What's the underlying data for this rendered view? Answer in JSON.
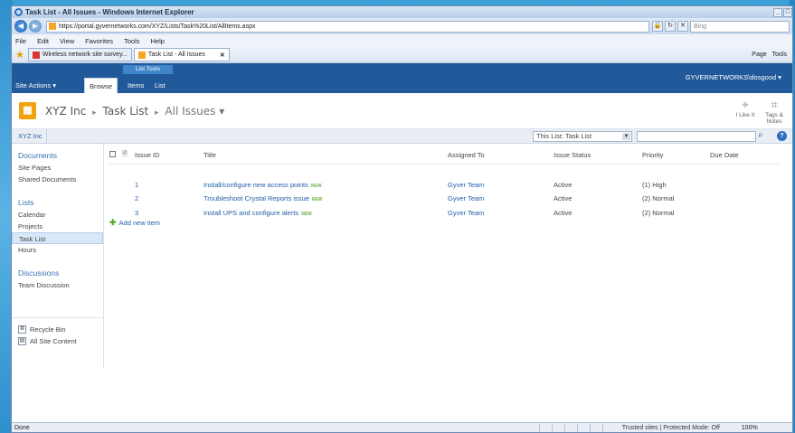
{
  "window": {
    "title": "Task List - All Issues - Windows Internet Explorer",
    "url": "https://portal.gyvernetworks.com/XYZ/Lists/Task%20List/AllItems.aspx",
    "search_placeholder": "Bing"
  },
  "menu": [
    "File",
    "Edit",
    "View",
    "Favorites",
    "Tools",
    "Help"
  ],
  "favorites": {
    "tabs": [
      {
        "label": "Wireless network site survey..."
      },
      {
        "label": "Task List - All Issues"
      }
    ],
    "commands": [
      "Page",
      "Tools"
    ]
  },
  "ribbon": {
    "site_actions": "Site Actions",
    "context_label": "List Tools",
    "tabs": [
      "Browse",
      "Items",
      "List"
    ],
    "user": "GYVERNETWORKS\\dosgood"
  },
  "title_area": {
    "site": "XYZ Inc",
    "list": "Task List",
    "view": "All Issues",
    "i_like_it": "I Like It",
    "tags_notes": "Tags & Notes"
  },
  "search_row": {
    "site_link": "XYZ Inc",
    "scope": "This List: Task List"
  },
  "leftnav": {
    "documents_header": "Documents",
    "documents": [
      "Site Pages",
      "Shared Documents"
    ],
    "lists_header": "Lists",
    "lists": [
      "Calendar",
      "Projects",
      "Task List",
      "Hours"
    ],
    "discussions_header": "Discussions",
    "discussions": [
      "Team Discussion"
    ],
    "footer": [
      "Recycle Bin",
      "All Site Content"
    ]
  },
  "table": {
    "headers": [
      "Issue ID",
      "Title",
      "Assigned To",
      "Issue Status",
      "Priority",
      "Due Date"
    ],
    "rows": [
      {
        "id": "1",
        "title": "Install/configure new access points",
        "assigned": "Gyver Team",
        "status": "Active",
        "priority": "(1) High",
        "due": ""
      },
      {
        "id": "2",
        "title": "Troubleshoot Crystal Reports issue",
        "assigned": "Gyver Team",
        "status": "Active",
        "priority": "(2) Normal",
        "due": ""
      },
      {
        "id": "3",
        "title": "Install UPS and configure alerts",
        "assigned": "Gyver Team",
        "status": "Active",
        "priority": "(2) Normal",
        "due": ""
      }
    ],
    "new_tag": "NEW",
    "add_new": "Add new item"
  },
  "status": {
    "left": "Done",
    "zone": "Trusted sites | Protected Mode: Off",
    "zoom": "100%"
  }
}
